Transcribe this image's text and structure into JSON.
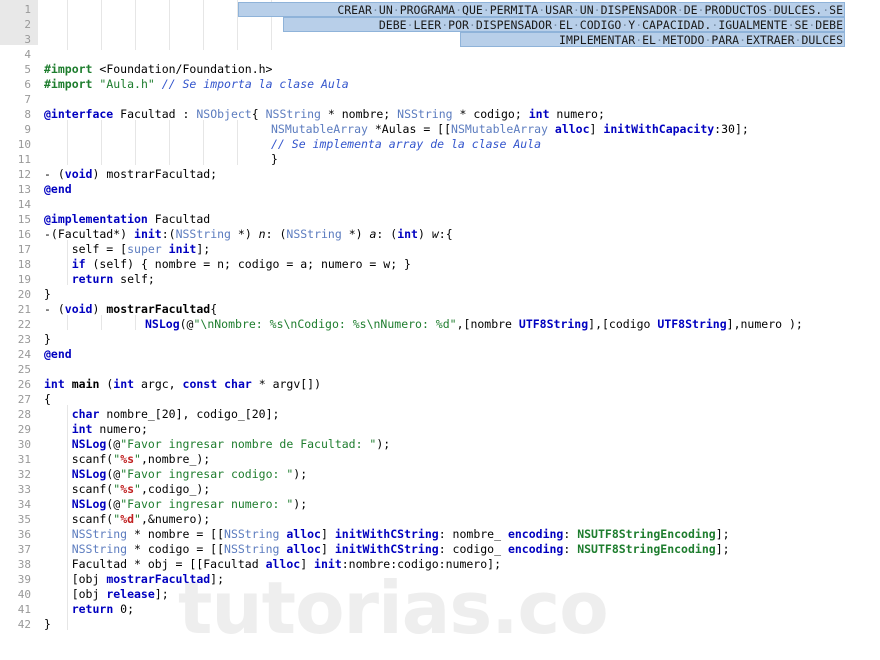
{
  "editor": {
    "language": "Objective-C",
    "total_lines": 42,
    "font_size_px": 11.5,
    "line_height_px": 15,
    "colors": {
      "background": "#ffffff",
      "gutter_background": "#ffffff",
      "gutter_selection": "#e8e8e8",
      "line_number": "#999999",
      "selection_fill": "#b8cfe9",
      "selection_border": "#8fb3d9",
      "keyword": "#0000c0",
      "preprocessor": "#1e7d2e",
      "string": "#1e7d2e",
      "comment": "#3355cc",
      "type": "#5c7cbf",
      "format_specifier": "#c02020",
      "plain_text": "#000000",
      "indent_guide": "#e6e6e6",
      "watermark": "#eeeeee"
    }
  },
  "watermark": {
    "text": "tutorias.co"
  },
  "gutter": {
    "numbers": [
      "1",
      "2",
      "3",
      "4",
      "5",
      "6",
      "7",
      "8",
      "9",
      "10",
      "11",
      "12",
      "13",
      "14",
      "15",
      "16",
      "17",
      "18",
      "19",
      "20",
      "21",
      "22",
      "23",
      "24",
      "25",
      "26",
      "27",
      "28",
      "29",
      "30",
      "31",
      "32",
      "33",
      "34",
      "35",
      "36",
      "37",
      "38",
      "39",
      "40",
      "41",
      "42"
    ],
    "highlighted_range": [
      1,
      3
    ]
  },
  "selected_header": {
    "selected": true,
    "lines": [
      "CREAR·UN·PROGRAMA·QUE·PERMITA·USAR·UN·DISPENSADOR·DE·PRODUCTOS·DULCES.·SE",
      "DEBE·LEER·POR·DISPENSADOR·EL·CODIGO·Y·CAPACIDAD.·IGUALMENTE·SE·DEBE",
      "IMPLEMENTAR·EL·METODO·PARA·EXTRAER·DULCES"
    ],
    "plain_text": [
      "CREAR UN PROGRAMA QUE PERMITA USAR UN DISPENSADOR DE PRODUCTOS DULCES. SE",
      "DEBE LEER POR DISPENSADOR EL CODIGO Y CAPACIDAD. IGUALMENTE SE DEBE",
      "IMPLEMENTAR EL METODO PARA EXTRAER DULCES"
    ]
  },
  "code": {
    "lines": [
      {
        "n": 4,
        "text": ""
      },
      {
        "n": 5,
        "text": "#import <Foundation/Foundation.h>"
      },
      {
        "n": 6,
        "text": "#import \"Aula.h\" // Se importa la clase Aula"
      },
      {
        "n": 7,
        "text": ""
      },
      {
        "n": 8,
        "text": "@interface Facultad : NSObject{ NSString * nombre; NSString * codigo; int numero;"
      },
      {
        "n": 9,
        "text": "                               NSMutableArray *Aulas = [[NSMutableArray alloc] initWithCapacity:30];"
      },
      {
        "n": 10,
        "text": "                               // Se implementa array de la clase Aula"
      },
      {
        "n": 11,
        "text": "                               }"
      },
      {
        "n": 12,
        "text": "- (void) mostrarFacultad;"
      },
      {
        "n": 13,
        "text": "@end"
      },
      {
        "n": 14,
        "text": ""
      },
      {
        "n": 15,
        "text": "@implementation Facultad"
      },
      {
        "n": 16,
        "text": "-(Facultad*) init:(NSString *) n: (NSString *) a: (int) w:{"
      },
      {
        "n": 17,
        "text": "    self = [super init];"
      },
      {
        "n": 18,
        "text": "    if (self) { nombre = n; codigo = a; numero = w; }"
      },
      {
        "n": 19,
        "text": "    return self;"
      },
      {
        "n": 20,
        "text": "}"
      },
      {
        "n": 21,
        "text": "- (void) mostrarFacultad{"
      },
      {
        "n": 22,
        "text": "        NSLog(@\"\\nNombre: %s\\nCodigo: %s\\nNumero: %d\",[nombre UTF8String],[codigo UTF8String],numero );"
      },
      {
        "n": 23,
        "text": "}"
      },
      {
        "n": 24,
        "text": "@end"
      },
      {
        "n": 25,
        "text": ""
      },
      {
        "n": 26,
        "text": "int main (int argc, const char * argv[])"
      },
      {
        "n": 27,
        "text": "{"
      },
      {
        "n": 28,
        "text": "    char nombre_[20], codigo_[20];"
      },
      {
        "n": 29,
        "text": "    int numero;"
      },
      {
        "n": 30,
        "text": "    NSLog(@\"Favor ingresar nombre de Facultad: \");"
      },
      {
        "n": 31,
        "text": "    scanf(\"%s\",nombre_);"
      },
      {
        "n": 32,
        "text": "    NSLog(@\"Favor ingresar codigo: \");"
      },
      {
        "n": 33,
        "text": "    scanf(\"%s\",codigo_);"
      },
      {
        "n": 34,
        "text": "    NSLog(@\"Favor ingresar numero: \");"
      },
      {
        "n": 35,
        "text": "    scanf(\"%d\",&numero);"
      },
      {
        "n": 36,
        "text": "    NSString * nombre = [[NSString alloc] initWithCString: nombre_ encoding: NSUTF8StringEncoding];"
      },
      {
        "n": 37,
        "text": "    NSString * codigo = [[NSString alloc] initWithCString: codigo_ encoding: NSUTF8StringEncoding];"
      },
      {
        "n": 38,
        "text": "    Facultad * obj = [[Facultad alloc] init:nombre:codigo:numero];"
      },
      {
        "n": 39,
        "text": "    [obj mostrarFacultad];"
      },
      {
        "n": 40,
        "text": "    [obj release];"
      },
      {
        "n": 41,
        "text": "    return 0;"
      },
      {
        "n": 42,
        "text": "}"
      }
    ]
  }
}
